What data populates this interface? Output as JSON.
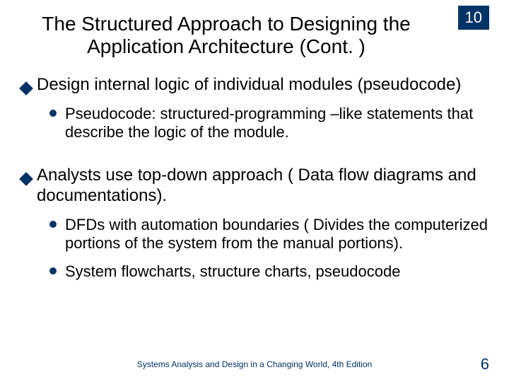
{
  "chapter_number": "10",
  "title": "The Structured Approach to Designing the Application Architecture (Cont. )",
  "bullets": {
    "b1": "Design internal logic of individual modules (pseudocode)",
    "b1_1": "Pseudocode: structured-programming –like statements that describe the logic of the module.",
    "b2": "Analysts use top-down approach ( Data flow diagrams and documentations).",
    "b2_1": "DFDs with automation boundaries ( Divides the computerized portions of the system from the manual portions).",
    "b2_2": "System flowcharts, structure charts, pseudocode"
  },
  "footer": "Systems Analysis and Design in a Changing World, 4th Edition",
  "page_number": "6"
}
